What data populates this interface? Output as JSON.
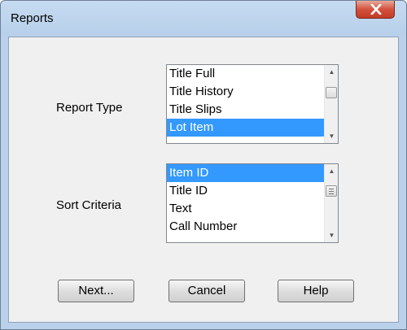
{
  "window": {
    "title": "Reports",
    "close_icon": "close-icon"
  },
  "report_type": {
    "label": "Report Type",
    "items": [
      {
        "text": "Title Full"
      },
      {
        "text": "Title History"
      },
      {
        "text": "Title Slips"
      },
      {
        "text": "Lot Item",
        "selected": true
      }
    ]
  },
  "sort_criteria": {
    "label": "Sort Criteria",
    "items": [
      {
        "text": "Item ID",
        "selected": true
      },
      {
        "text": "Title ID"
      },
      {
        "text": "Text"
      },
      {
        "text": "Call Number"
      }
    ]
  },
  "buttons": {
    "next": "Next...",
    "cancel": "Cancel",
    "help": "Help"
  },
  "colors": {
    "selection": "#3399ff",
    "frame": "#b9d1ea",
    "close": "#c9452f"
  }
}
